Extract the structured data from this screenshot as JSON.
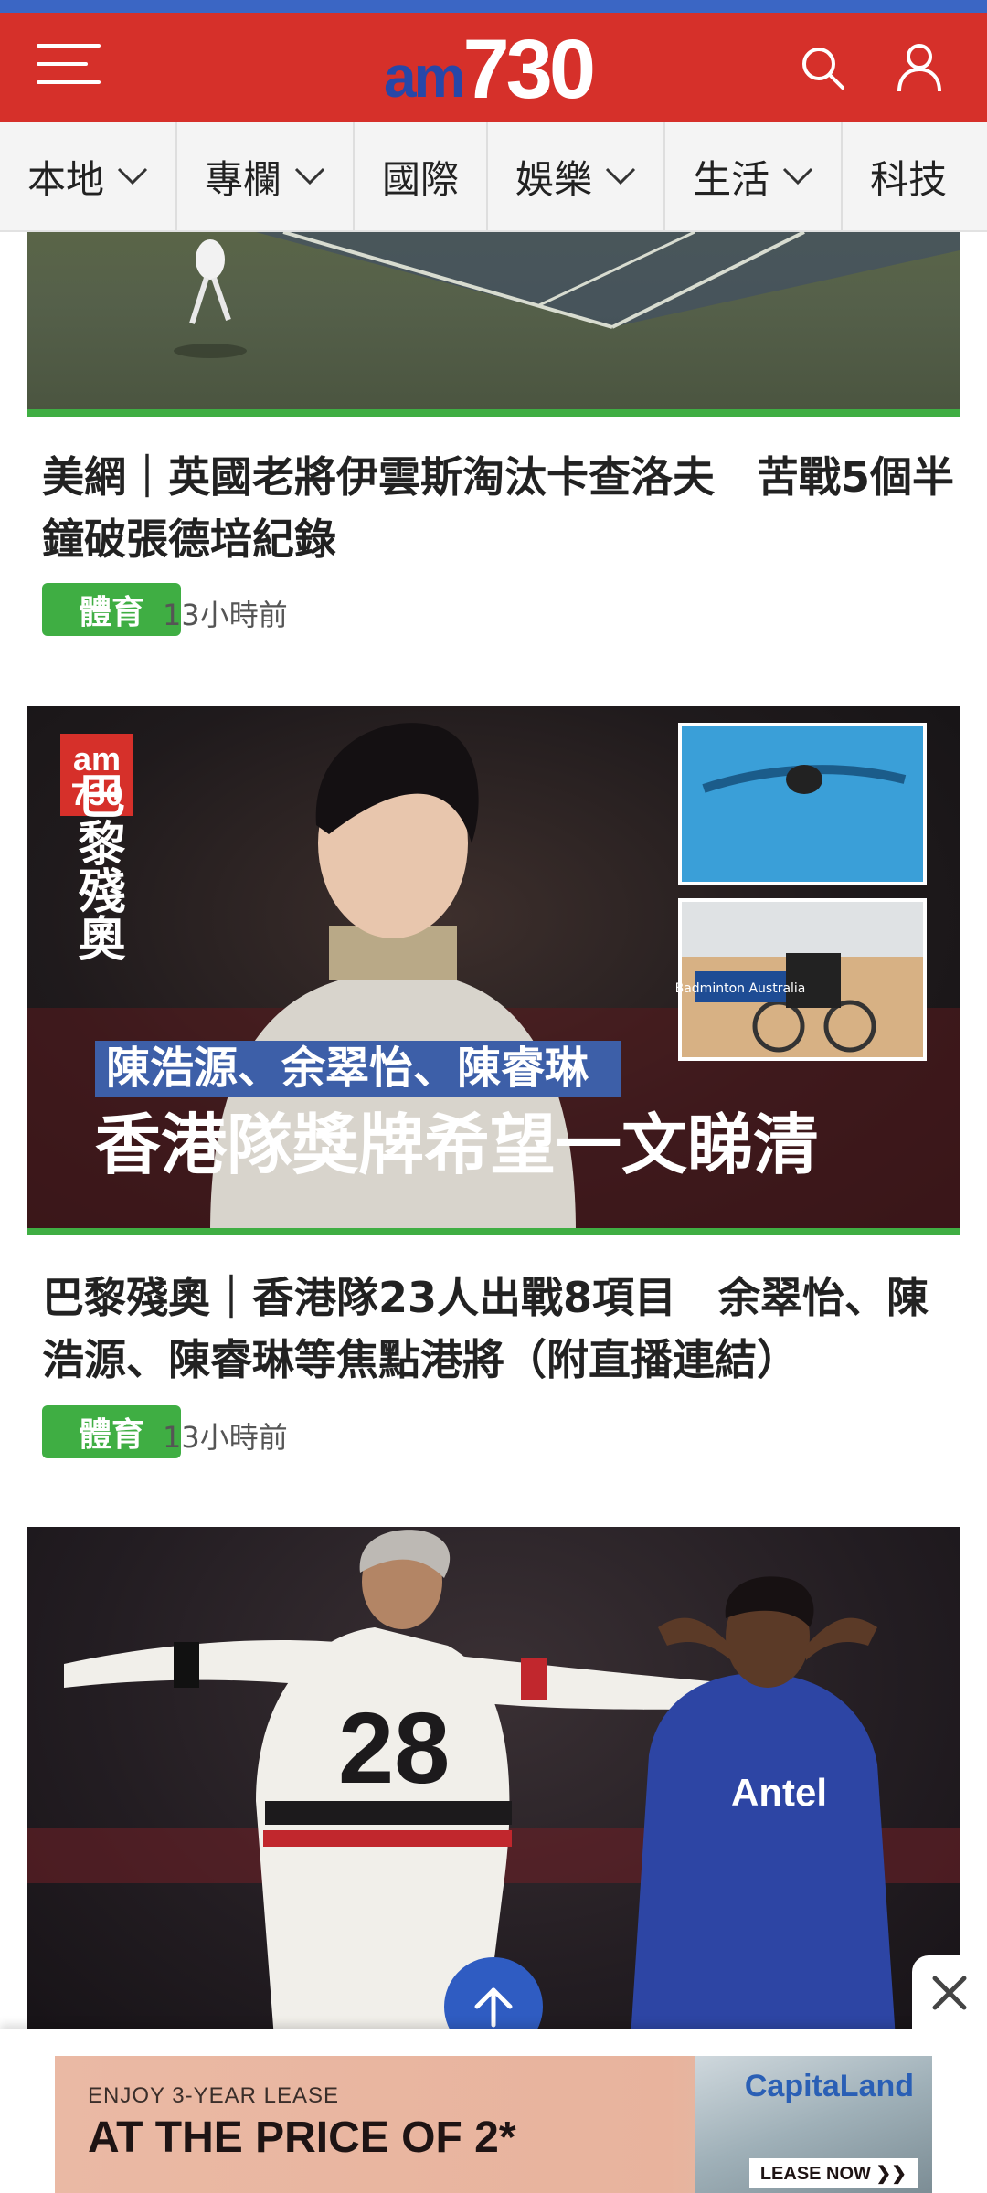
{
  "header": {
    "logo_am": "am",
    "logo_num": "730"
  },
  "nav": {
    "items": [
      {
        "label": "本地",
        "has_dropdown": true
      },
      {
        "label": "專欄",
        "has_dropdown": true
      },
      {
        "label": "國際",
        "has_dropdown": false
      },
      {
        "label": "娛樂",
        "has_dropdown": true
      },
      {
        "label": "生活",
        "has_dropdown": true
      },
      {
        "label": "科技",
        "has_dropdown": false
      }
    ]
  },
  "articles": [
    {
      "headline": "美網｜英國老將伊雲斯淘汰卡查洛夫　苦戰5個半鐘破張德培紀錄",
      "tag": "體育",
      "time": "13小時前"
    },
    {
      "image_badge_am": "am",
      "image_badge_num": "730",
      "image_vertical": "巴黎殘奧",
      "image_caption_small": "陳浩源、余翠怡、陳睿琳",
      "image_caption_big": "香港隊獎牌希望一文睇清",
      "image_inset_text": "Badminton Australia",
      "headline": "巴黎殘奧｜香港隊23人出戰8項目　余翠怡、陳浩源、陳睿琳等焦點港將（附直播連結）",
      "tag": "體育",
      "time": "13小時前"
    },
    {
      "image_jersey_number": "28",
      "image_jersey_brand": "Antel"
    }
  ],
  "ad": {
    "line1": "ENJOY 3-YEAR LEASE",
    "line2": "AT THE PRICE OF 2*",
    "brand": "CapitaLand",
    "cta": "LEASE NOW ❯❯"
  },
  "colors": {
    "brand_red": "#d6302a",
    "logo_blue": "#2747a8",
    "tag_green": "#3fae43",
    "fab_blue": "#2f5cc2"
  }
}
